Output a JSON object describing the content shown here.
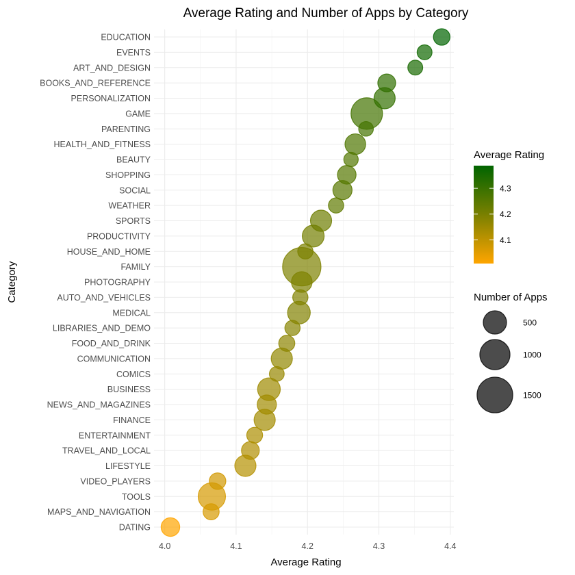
{
  "chart_data": {
    "type": "scatter",
    "title": "Average Rating and Number of Apps by Category",
    "xlabel": "Average Rating",
    "ylabel": "Category",
    "xlim": [
      3.985,
      4.405
    ],
    "xticks": [
      4.0,
      4.1,
      4.2,
      4.3,
      4.4
    ],
    "xtick_labels": [
      "4.0",
      "4.1",
      "4.2",
      "4.3",
      "4.4"
    ],
    "grid": true,
    "color_scale": {
      "title": "Average Rating",
      "low_color": "#FFA500",
      "high_color": "#006400",
      "range": [
        4.008,
        4.388
      ],
      "ticks": [
        4.1,
        4.2,
        4.3
      ],
      "tick_labels": [
        "4.1",
        "4.2",
        "4.3"
      ],
      "placement": "right"
    },
    "size_legend": {
      "title": "Number of Apps",
      "breaks": [
        500,
        1000,
        1500
      ],
      "labels": [
        "500",
        "1000",
        "1500"
      ],
      "placement": "right"
    },
    "point_alpha": 0.7,
    "points": [
      {
        "category": "EDUCATION",
        "rating": 4.388,
        "apps": 130
      },
      {
        "category": "EVENTS",
        "rating": 4.364,
        "apps": 60
      },
      {
        "category": "ART_AND_DESIGN",
        "rating": 4.351,
        "apps": 60
      },
      {
        "category": "BOOKS_AND_REFERENCE",
        "rating": 4.311,
        "apps": 190
      },
      {
        "category": "PERSONALIZATION",
        "rating": 4.308,
        "apps": 370
      },
      {
        "category": "GAME",
        "rating": 4.283,
        "apps": 1110
      },
      {
        "category": "PARENTING",
        "rating": 4.282,
        "apps": 50
      },
      {
        "category": "HEALTH_AND_FITNESS",
        "rating": 4.267,
        "apps": 340
      },
      {
        "category": "BEAUTY",
        "rating": 4.261,
        "apps": 40
      },
      {
        "category": "SHOPPING",
        "rating": 4.255,
        "apps": 230
      },
      {
        "category": "SOCIAL",
        "rating": 4.249,
        "apps": 260
      },
      {
        "category": "WEATHER",
        "rating": 4.24,
        "apps": 75
      },
      {
        "category": "SPORTS",
        "rating": 4.219,
        "apps": 370
      },
      {
        "category": "PRODUCTIVITY",
        "rating": 4.208,
        "apps": 410
      },
      {
        "category": "HOUSE_AND_HOME",
        "rating": 4.197,
        "apps": 75
      },
      {
        "category": "FAMILY",
        "rating": 4.192,
        "apps": 1770
      },
      {
        "category": "PHOTOGRAPHY",
        "rating": 4.192,
        "apps": 340
      },
      {
        "category": "AUTO_AND_VEHICLES",
        "rating": 4.19,
        "apps": 75
      },
      {
        "category": "MEDICAL",
        "rating": 4.188,
        "apps": 460
      },
      {
        "category": "LIBRARIES_AND_DEMO",
        "rating": 4.179,
        "apps": 75
      },
      {
        "category": "FOOD_AND_DRINK",
        "rating": 4.171,
        "apps": 110
      },
      {
        "category": "COMMUNICATION",
        "rating": 4.164,
        "apps": 370
      },
      {
        "category": "COMICS",
        "rating": 4.157,
        "apps": 55
      },
      {
        "category": "BUSINESS",
        "rating": 4.146,
        "apps": 460
      },
      {
        "category": "NEWS_AND_MAGAZINES",
        "rating": 4.143,
        "apps": 260
      },
      {
        "category": "FINANCE",
        "rating": 4.14,
        "apps": 370
      },
      {
        "category": "ENTERTAINMENT",
        "rating": 4.126,
        "apps": 100
      },
      {
        "category": "TRAVEL_AND_LOCAL",
        "rating": 4.12,
        "apps": 190
      },
      {
        "category": "LIFESTYLE",
        "rating": 4.113,
        "apps": 370
      },
      {
        "category": "VIDEO_PLAYERS",
        "rating": 4.074,
        "apps": 130
      },
      {
        "category": "TOOLS",
        "rating": 4.066,
        "apps": 780
      },
      {
        "category": "MAPS_AND_NAVIGATION",
        "rating": 4.065,
        "apps": 110
      },
      {
        "category": "DATING",
        "rating": 4.008,
        "apps": 230
      }
    ]
  }
}
